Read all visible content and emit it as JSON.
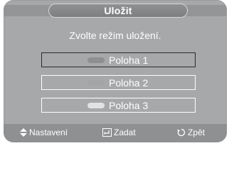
{
  "dialog": {
    "title": "Uložit",
    "prompt": "Zvolte režim uložení.",
    "options": [
      {
        "label": "Poloha 1",
        "selected": true,
        "swatch_color": "#8e8f91"
      },
      {
        "label": "Poloha 2",
        "selected": false,
        "swatch_color": "#a3a4a6"
      },
      {
        "label": "Poloha 3",
        "selected": false,
        "swatch_color": "#e1e2e3"
      }
    ]
  },
  "footer": {
    "navigate_label": "Nastavení",
    "navigate_icon": "up-down-arrows-icon",
    "enter_label": "Zadat",
    "enter_icon": "enter-icon",
    "return_label": "Zpět",
    "return_icon": "return-icon"
  },
  "colors": {
    "panel": "#a7a8aa",
    "title_pill": "#858688",
    "footer": "#8f9092",
    "text": "#ffffff",
    "selected_border": "#2b2b2b"
  }
}
